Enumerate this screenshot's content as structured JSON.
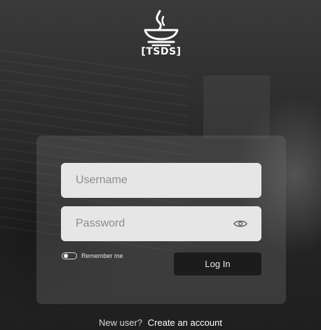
{
  "brand": {
    "name": "TSDS",
    "logo_icon": "flame-bowl-icon"
  },
  "login_form": {
    "username_placeholder": "Username",
    "password_placeholder": "Password",
    "password_toggle_icon": "eye-icon",
    "remember_label": "Remember me",
    "remember_checked": false,
    "login_button": "Log In"
  },
  "footer": {
    "prompt": "New user?",
    "link": "Create an account"
  },
  "colors": {
    "card_background": "#6e6e6e",
    "input_background": "#e6e6e6",
    "button_background": "#1c1c1c"
  }
}
